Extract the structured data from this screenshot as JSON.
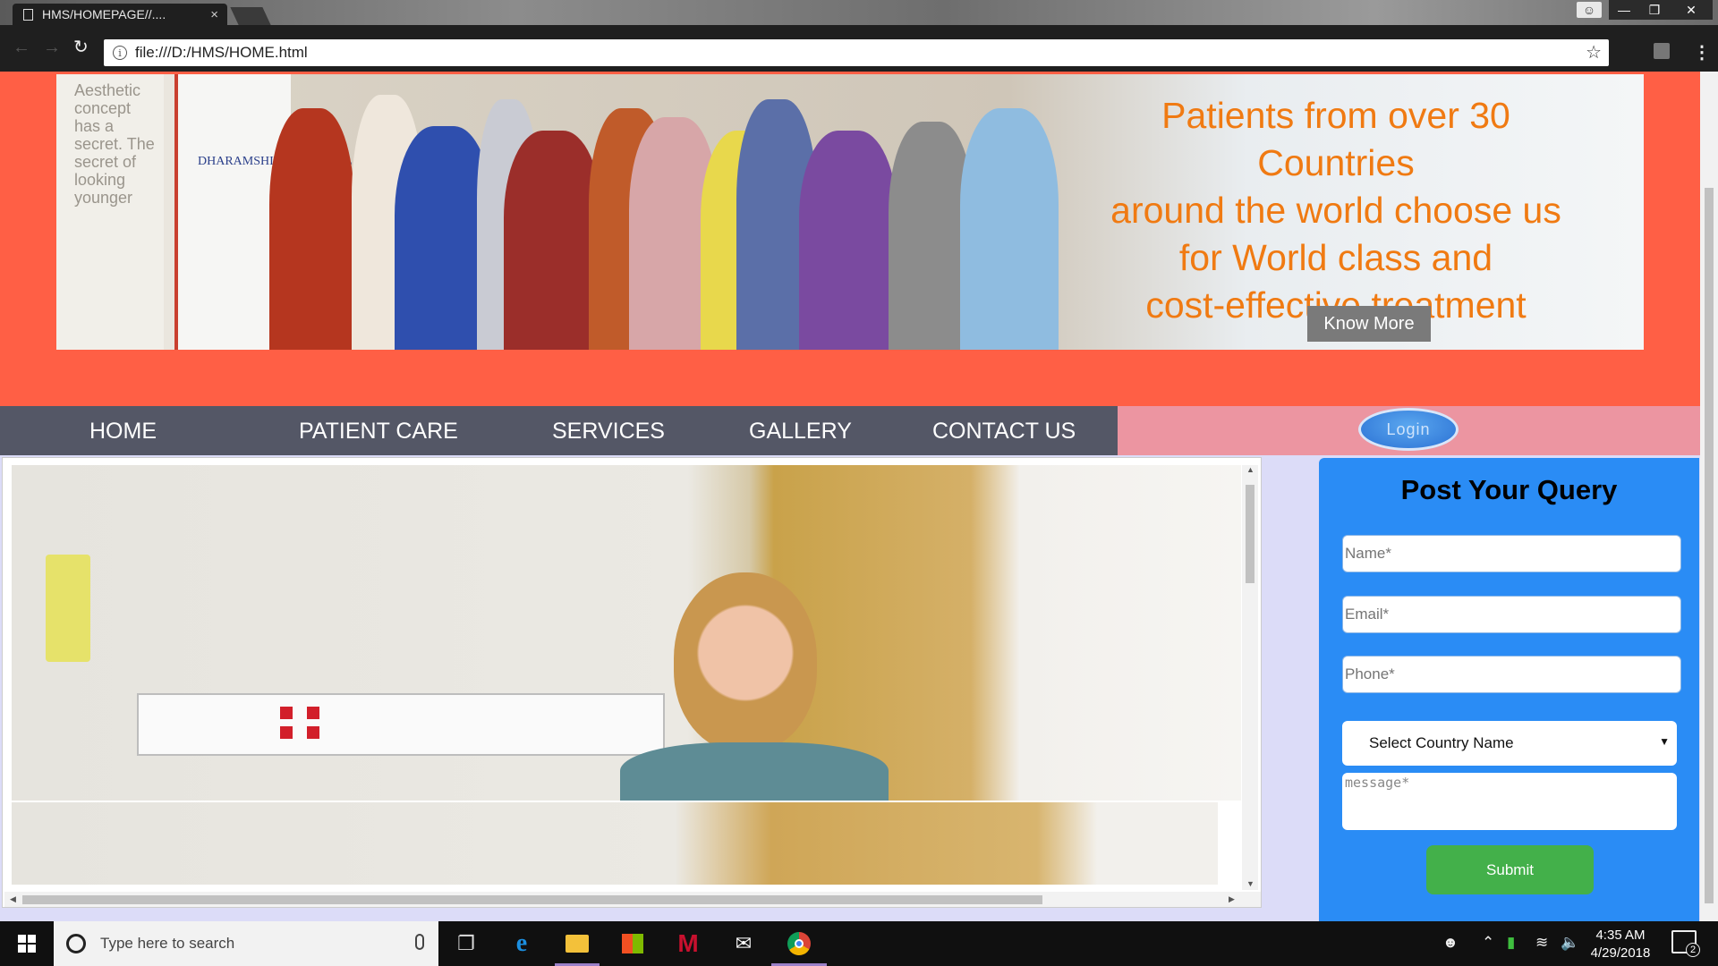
{
  "browser": {
    "tab_title": "HMS/HOMEPAGE//....",
    "tab_close": "×",
    "url": "file:///D:/HMS/HOME.html"
  },
  "banner": {
    "poster_tagline": "Aesthetic concept has a secret. The secret of looking younger",
    "standee_logo": "DHARAMSHILA HOSPITAL",
    "headline_lines": [
      "Patients from over 30 Countries",
      "around the world choose us",
      "for World class and",
      "cost-effective treatment"
    ],
    "button_label": "Know More",
    "text_color": "#f07a12"
  },
  "nav": {
    "items": [
      {
        "label": "HOME"
      },
      {
        "label": "PATIENT CARE"
      },
      {
        "label": "SERVICES"
      },
      {
        "label": "GALLERY"
      },
      {
        "label": "CONTACT US"
      }
    ],
    "login_label": "Login",
    "bar_color": "#545766",
    "accent_color": "#ec95a1"
  },
  "header_color": "#ff5f45",
  "query_form": {
    "title": "Post Your Query",
    "name_placeholder": "Name*",
    "email_placeholder": "Email*",
    "phone_placeholder": "Phone*",
    "country_select": "Select Country Name",
    "message_placeholder": "message*",
    "submit_label": "Submit",
    "panel_color": "#2a8cf5",
    "submit_color": "#43b04a"
  },
  "taskbar": {
    "search_placeholder": "Type here to search",
    "time": "4:35 AM",
    "date": "4/29/2018",
    "notification_count": "2",
    "apps": [
      "task-view-icon",
      "edge-icon",
      "file-explorer-icon",
      "store-icon",
      "mcafee-icon",
      "mail-icon",
      "chrome-icon"
    ]
  }
}
